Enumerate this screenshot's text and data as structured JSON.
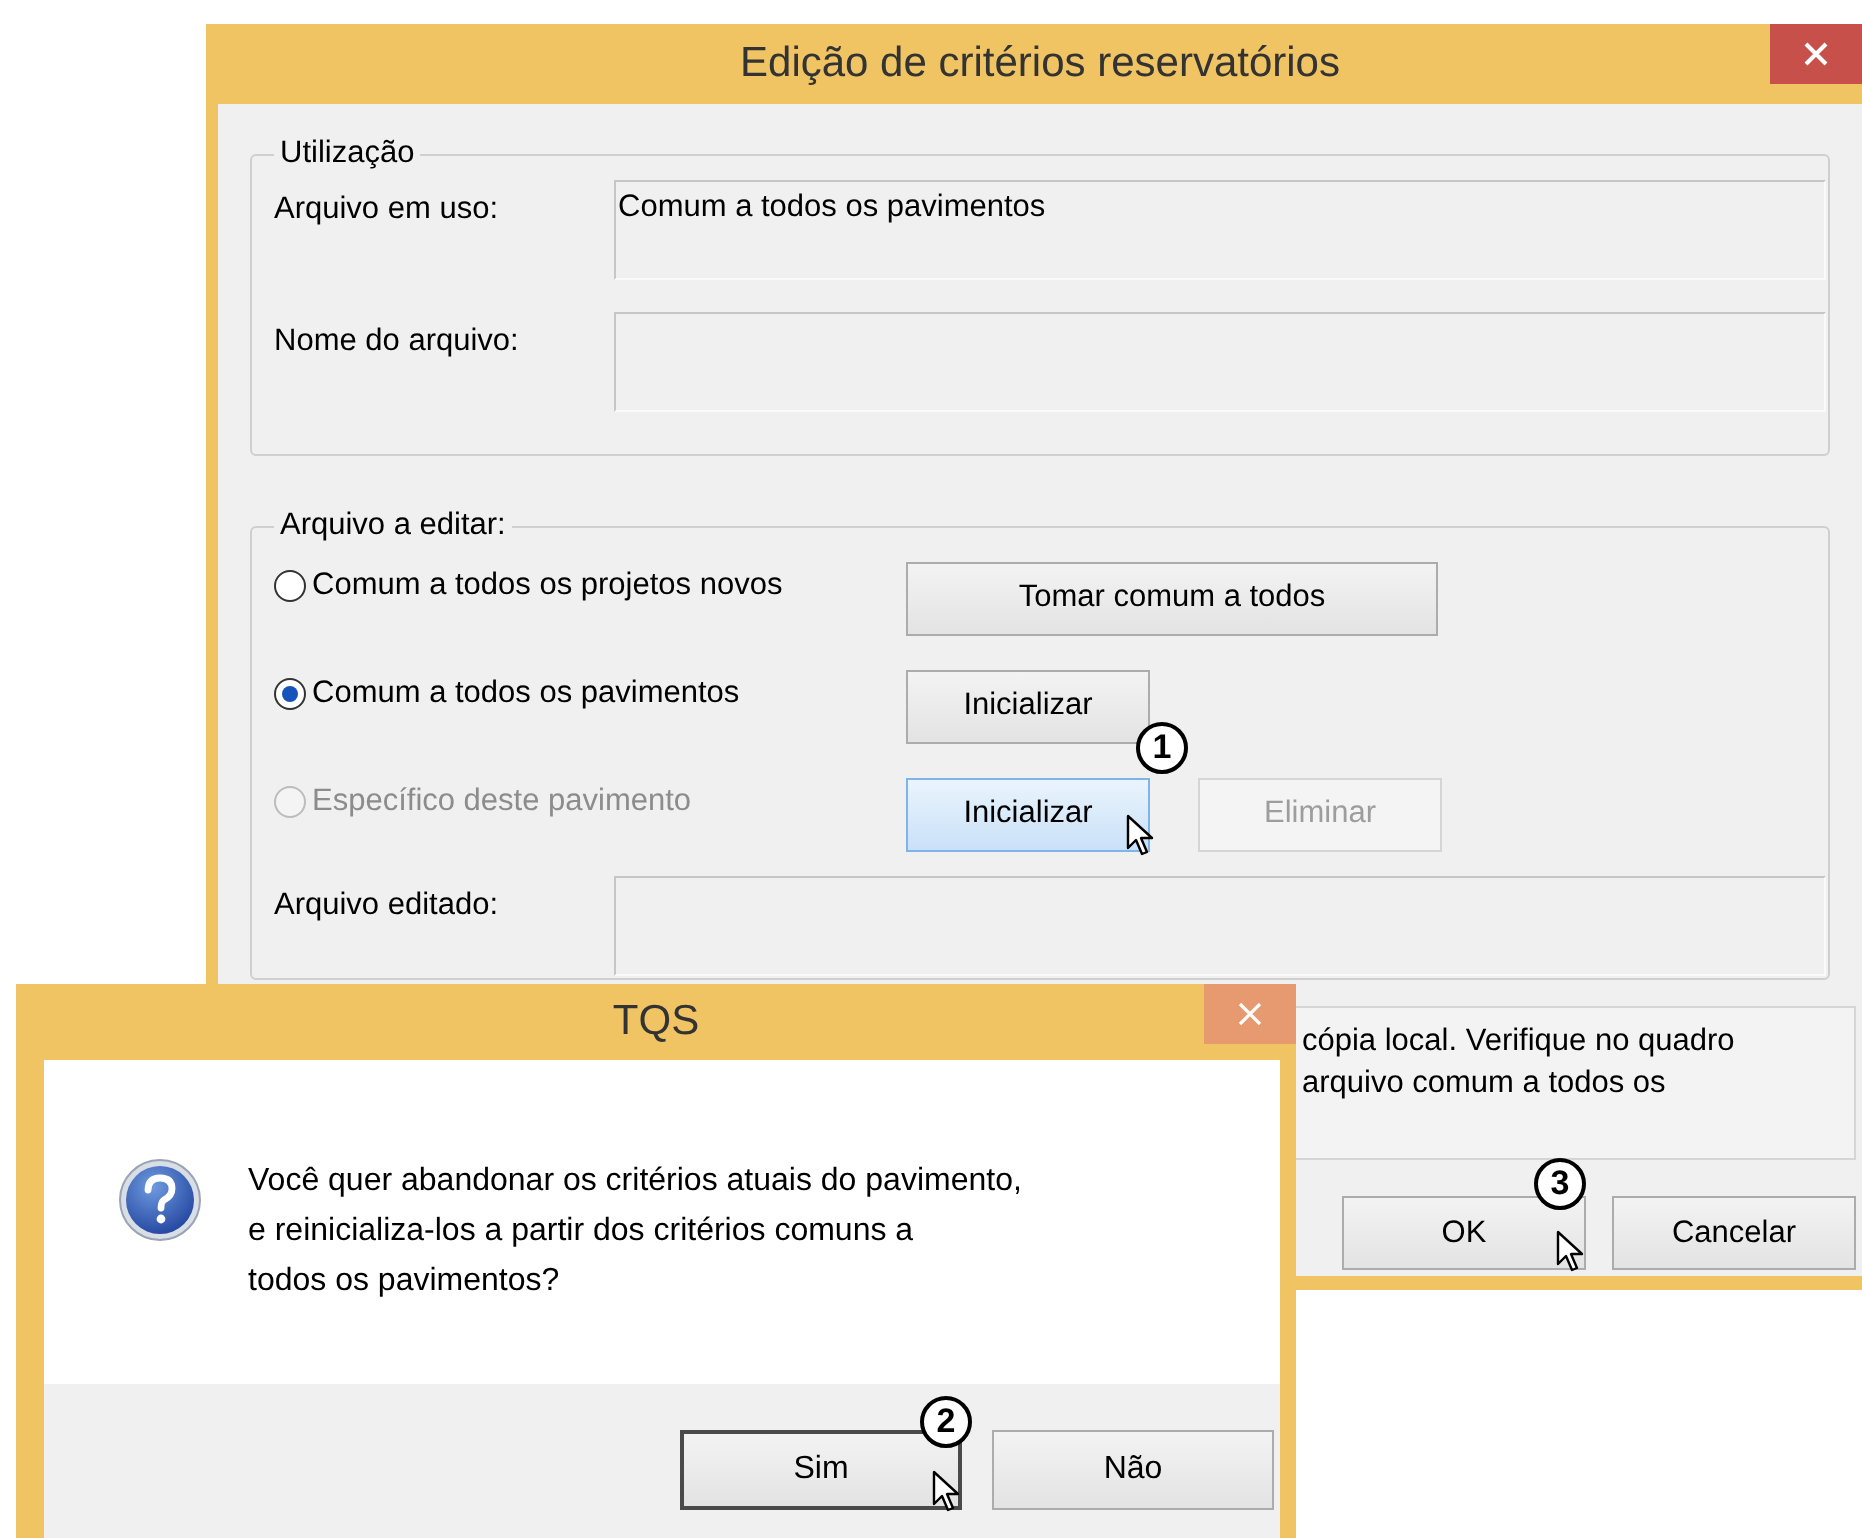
{
  "main_window": {
    "title": "Edição de critérios reservatórios",
    "usage_group": {
      "legend": "Utilização",
      "fields": [
        {
          "label": "Arquivo em uso:",
          "value": "Comum a todos os pavimentos"
        },
        {
          "label": "Nome do arquivo:"
        }
      ]
    },
    "edit_group": {
      "legend": "Arquivo a editar:",
      "options": [
        {
          "label": "Comum a todos os projetos novos",
          "selected": false,
          "disabled": false,
          "buttons": [
            {
              "label": "Tomar comum a todos",
              "hovered": false,
              "disabled": false
            }
          ]
        },
        {
          "label": "Comum a todos os pavimentos",
          "selected": true,
          "disabled": false,
          "buttons": [
            {
              "label": "Inicializar",
              "hovered": false,
              "disabled": false
            }
          ]
        },
        {
          "label": "Específico deste pavimento",
          "selected": false,
          "disabled": true,
          "buttons": [
            {
              "label": "Inicializar",
              "hovered": true,
              "disabled": false
            },
            {
              "label": "Eliminar",
              "hovered": false,
              "disabled": true
            }
          ]
        }
      ],
      "field": {
        "label": "Arquivo editado:"
      }
    },
    "info_lines": [
      "cópia local. Verifique no quadro",
      "arquivo comum a todos os"
    ],
    "buttons": [
      {
        "label": "OK"
      },
      {
        "label": "Cancelar"
      }
    ]
  },
  "message_box": {
    "title": "TQS",
    "lines": [
      "Você quer abandonar os critérios atuais do pavimento,",
      "e reinicializa-los a partir dos critérios comuns a",
      "todos os pavimentos?"
    ],
    "buttons": [
      {
        "label": "Sim",
        "focused": true
      },
      {
        "label": "Não",
        "focused": false
      }
    ]
  },
  "callouts": [
    {
      "number": "1"
    },
    {
      "number": "2"
    },
    {
      "number": "3"
    }
  ]
}
